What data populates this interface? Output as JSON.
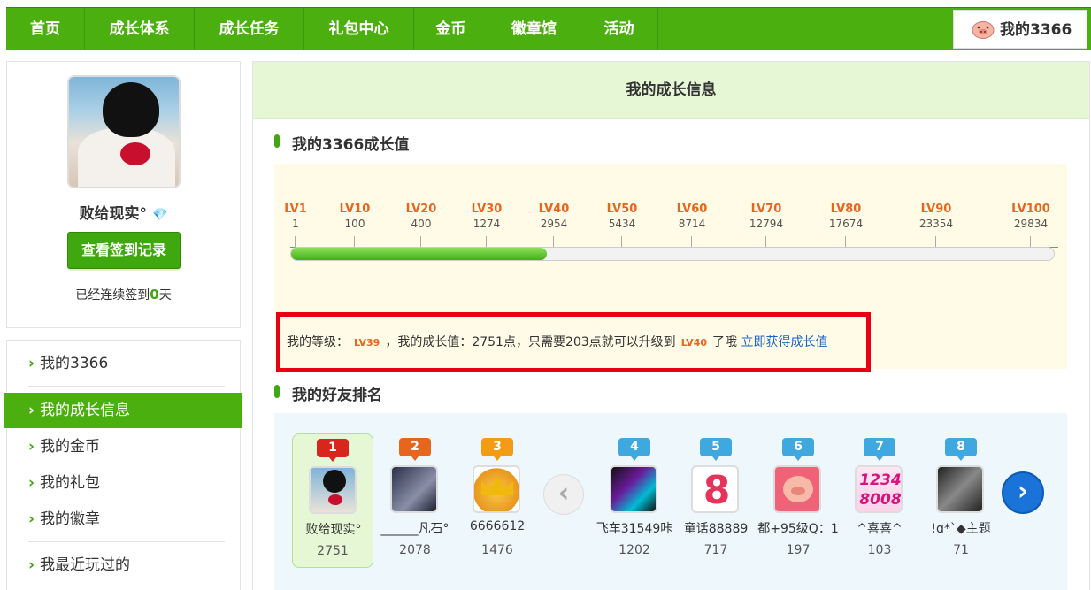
{
  "nav": {
    "items": [
      "首页",
      "成长体系",
      "成长任务",
      "礼包中心",
      "金币",
      "徽章馆",
      "活动"
    ],
    "user_label": "我的3366"
  },
  "profile": {
    "username": "败给现实°",
    "checkin_button": "查看签到记录",
    "streak_prefix": "已经连续签到",
    "streak_days": "0",
    "streak_suffix": "天"
  },
  "menu": {
    "items": [
      "我的3366",
      "我的成长信息",
      "我的金币",
      "我的礼包",
      "我的徽章",
      "我最近玩过的"
    ],
    "active_index": 1
  },
  "main": {
    "header": "我的成长信息",
    "growth_title": "我的3366成长值",
    "friends_title": "我的好友排名"
  },
  "levels": [
    {
      "name": "LV1",
      "value": "1"
    },
    {
      "name": "LV10",
      "value": "100"
    },
    {
      "name": "LV20",
      "value": "400"
    },
    {
      "name": "LV30",
      "value": "1274"
    },
    {
      "name": "LV40",
      "value": "2954"
    },
    {
      "name": "LV50",
      "value": "5434"
    },
    {
      "name": "LV60",
      "value": "8714"
    },
    {
      "name": "LV70",
      "value": "12794"
    },
    {
      "name": "LV80",
      "value": "17674"
    },
    {
      "name": "LV90",
      "value": "23354"
    },
    {
      "name": "LV100",
      "value": "29834"
    }
  ],
  "progress": {
    "fraction": 0.335
  },
  "level_info": {
    "prefix": "我的等级：",
    "current_level": "LV39",
    "middle": "，我的成长值：2751点，只需要203点就可以升级到",
    "next_level": "LV40",
    "suffix": "了哦",
    "link": "立即获得成长值"
  },
  "friends": [
    {
      "rank": "1",
      "name": "败给现实°",
      "score": "2751",
      "rank_color": "#d9261c",
      "me": true
    },
    {
      "rank": "2",
      "name": "______凡石°",
      "score": "2078",
      "rank_color": "#e8661c"
    },
    {
      "rank": "3",
      "name": "6666612",
      "score": "1476",
      "rank_color": "#f39c12"
    },
    {
      "rank": "4",
      "name": "飞车31549咔",
      "score": "1202",
      "rank_color": "#3fa9df"
    },
    {
      "rank": "5",
      "name": "童话88889",
      "score": "717",
      "rank_color": "#3fa9df"
    },
    {
      "rank": "6",
      "name": "都+95级Q：1",
      "score": "197",
      "rank_color": "#3fa9df"
    },
    {
      "rank": "7",
      "name": "^喜喜^",
      "score": "103",
      "rank_color": "#3fa9df"
    },
    {
      "rank": "8",
      "name": "!ɑ*`◆主题",
      "score": "71",
      "rank_color": "#3fa9df"
    }
  ]
}
